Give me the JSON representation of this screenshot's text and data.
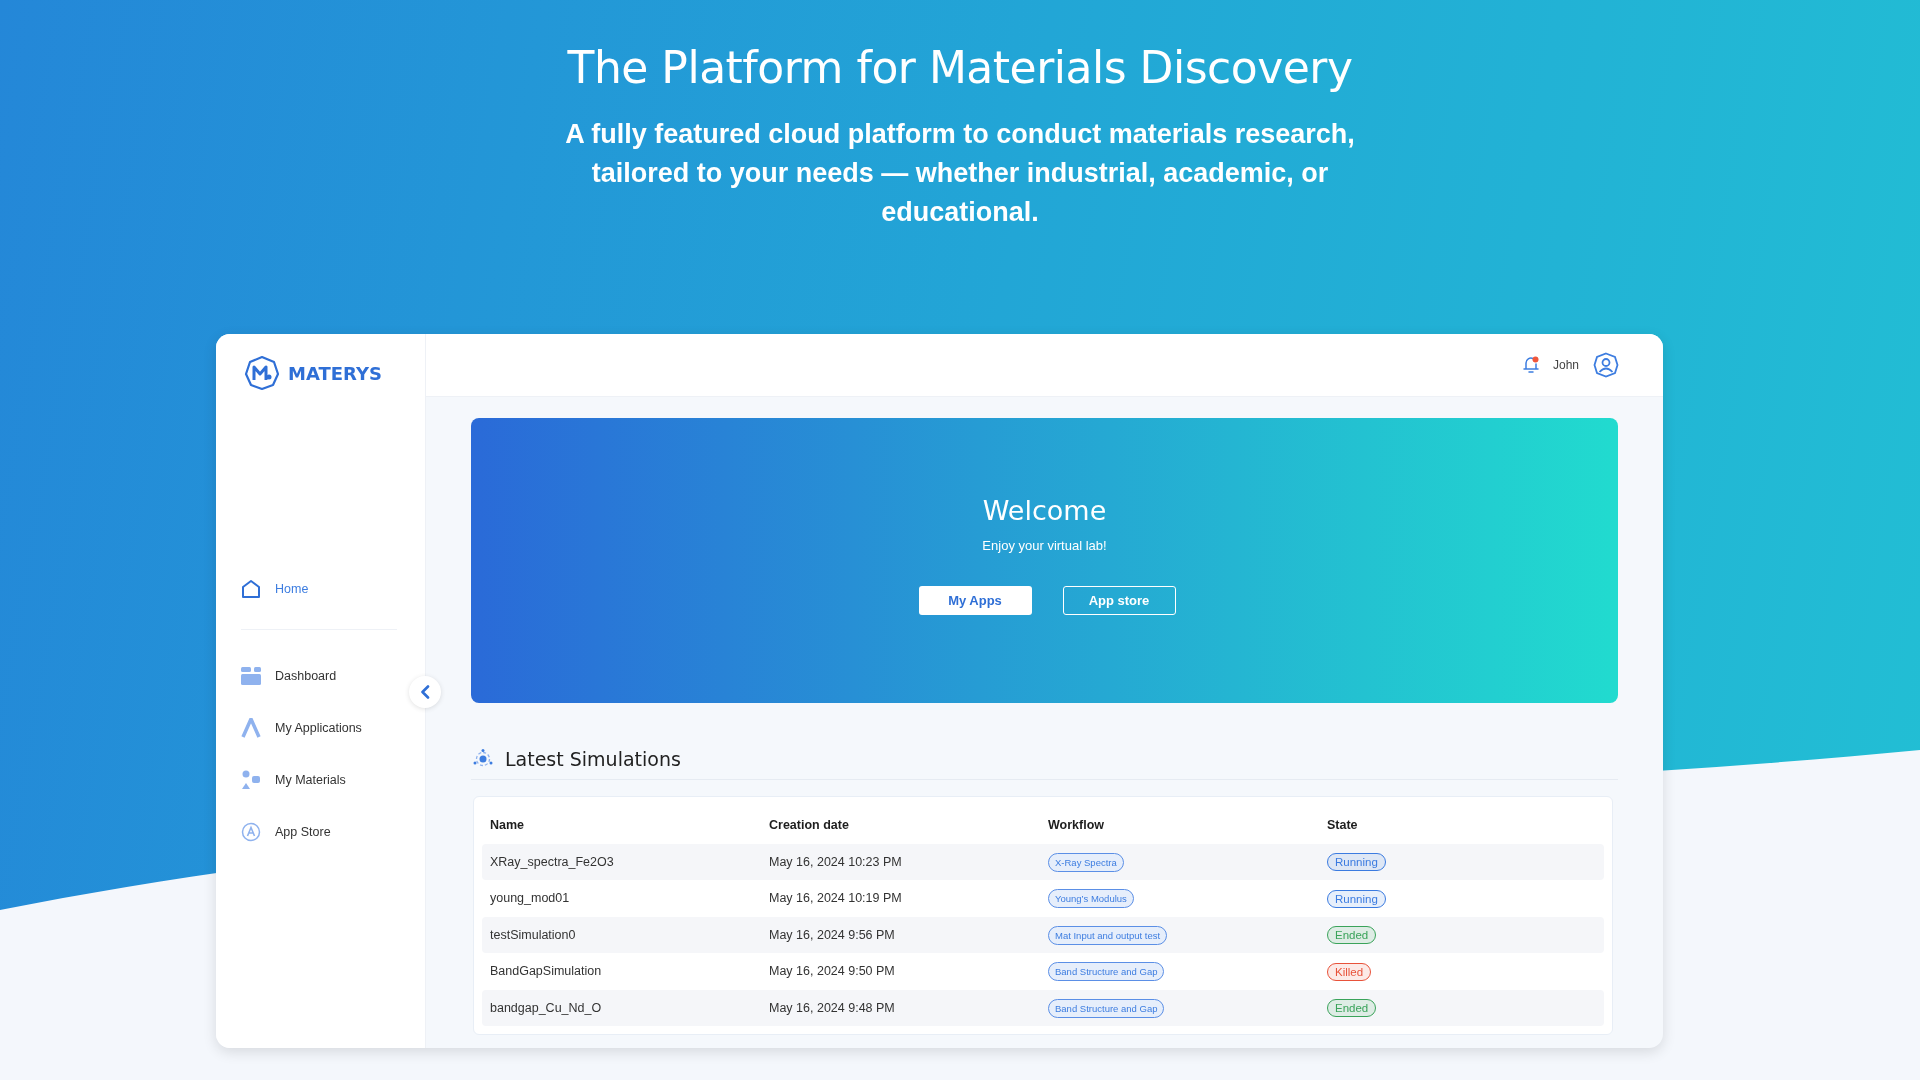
{
  "hero": {
    "title": "The Platform for Materials Discovery",
    "subtitle": "A fully featured cloud platform to conduct materials research, tailored to your needs — whether industrial, academic, or educational."
  },
  "app": {
    "logo": {
      "text": "MATERYS"
    },
    "sidebar": {
      "items": [
        {
          "label": "Home",
          "kind": "home",
          "selected": true
        },
        {
          "label": "Dashboard",
          "kind": "dashboard",
          "selected": false
        },
        {
          "label": "My Applications",
          "kind": "applications",
          "selected": false
        },
        {
          "label": "My Materials",
          "kind": "materials",
          "selected": false
        },
        {
          "label": "App Store",
          "kind": "store",
          "selected": false
        }
      ]
    },
    "header": {
      "notifications": {
        "unread": true
      },
      "user": "John"
    },
    "banner": {
      "title": "Welcome",
      "subtitle": "Enjoy your virtual lab!",
      "buttons": [
        {
          "label": "My Apps",
          "kind": "filled"
        },
        {
          "label": "App store",
          "kind": "outline"
        }
      ]
    },
    "simulations": {
      "title": "Latest Simulations",
      "columns": [
        "Name",
        "Creation date",
        "Workflow",
        "State"
      ],
      "rows": [
        {
          "name": "XRay_spectra_Fe2O3",
          "date": "May 16, 2024 10:23 PM",
          "workflow": "X-Ray Spectra",
          "state": {
            "label": "Running",
            "color": "#3b7be0"
          }
        },
        {
          "name": "young_mod01",
          "date": "May 16, 2024 10:19 PM",
          "workflow": "Young’s Modulus",
          "state": {
            "label": "Running",
            "color": "#3b7be0"
          }
        },
        {
          "name": "testSimulation0",
          "date": "May 16, 2024 9:56 PM",
          "workflow": "Mat Input and output test",
          "state": {
            "label": "Ended",
            "color": "#3aa35a"
          }
        },
        {
          "name": "BandGapSimulation",
          "date": "May 16, 2024 9:50 PM",
          "workflow": "Band Structure and Gap",
          "state": {
            "label": "Killed",
            "color": "#e8523a"
          }
        },
        {
          "name": "bandgap_Cu_Nd_O",
          "date": "May 16, 2024 9:48 PM",
          "workflow": "Band Structure and Gap",
          "state": {
            "label": "Ended",
            "color": "#3aa35a"
          }
        }
      ]
    }
  }
}
